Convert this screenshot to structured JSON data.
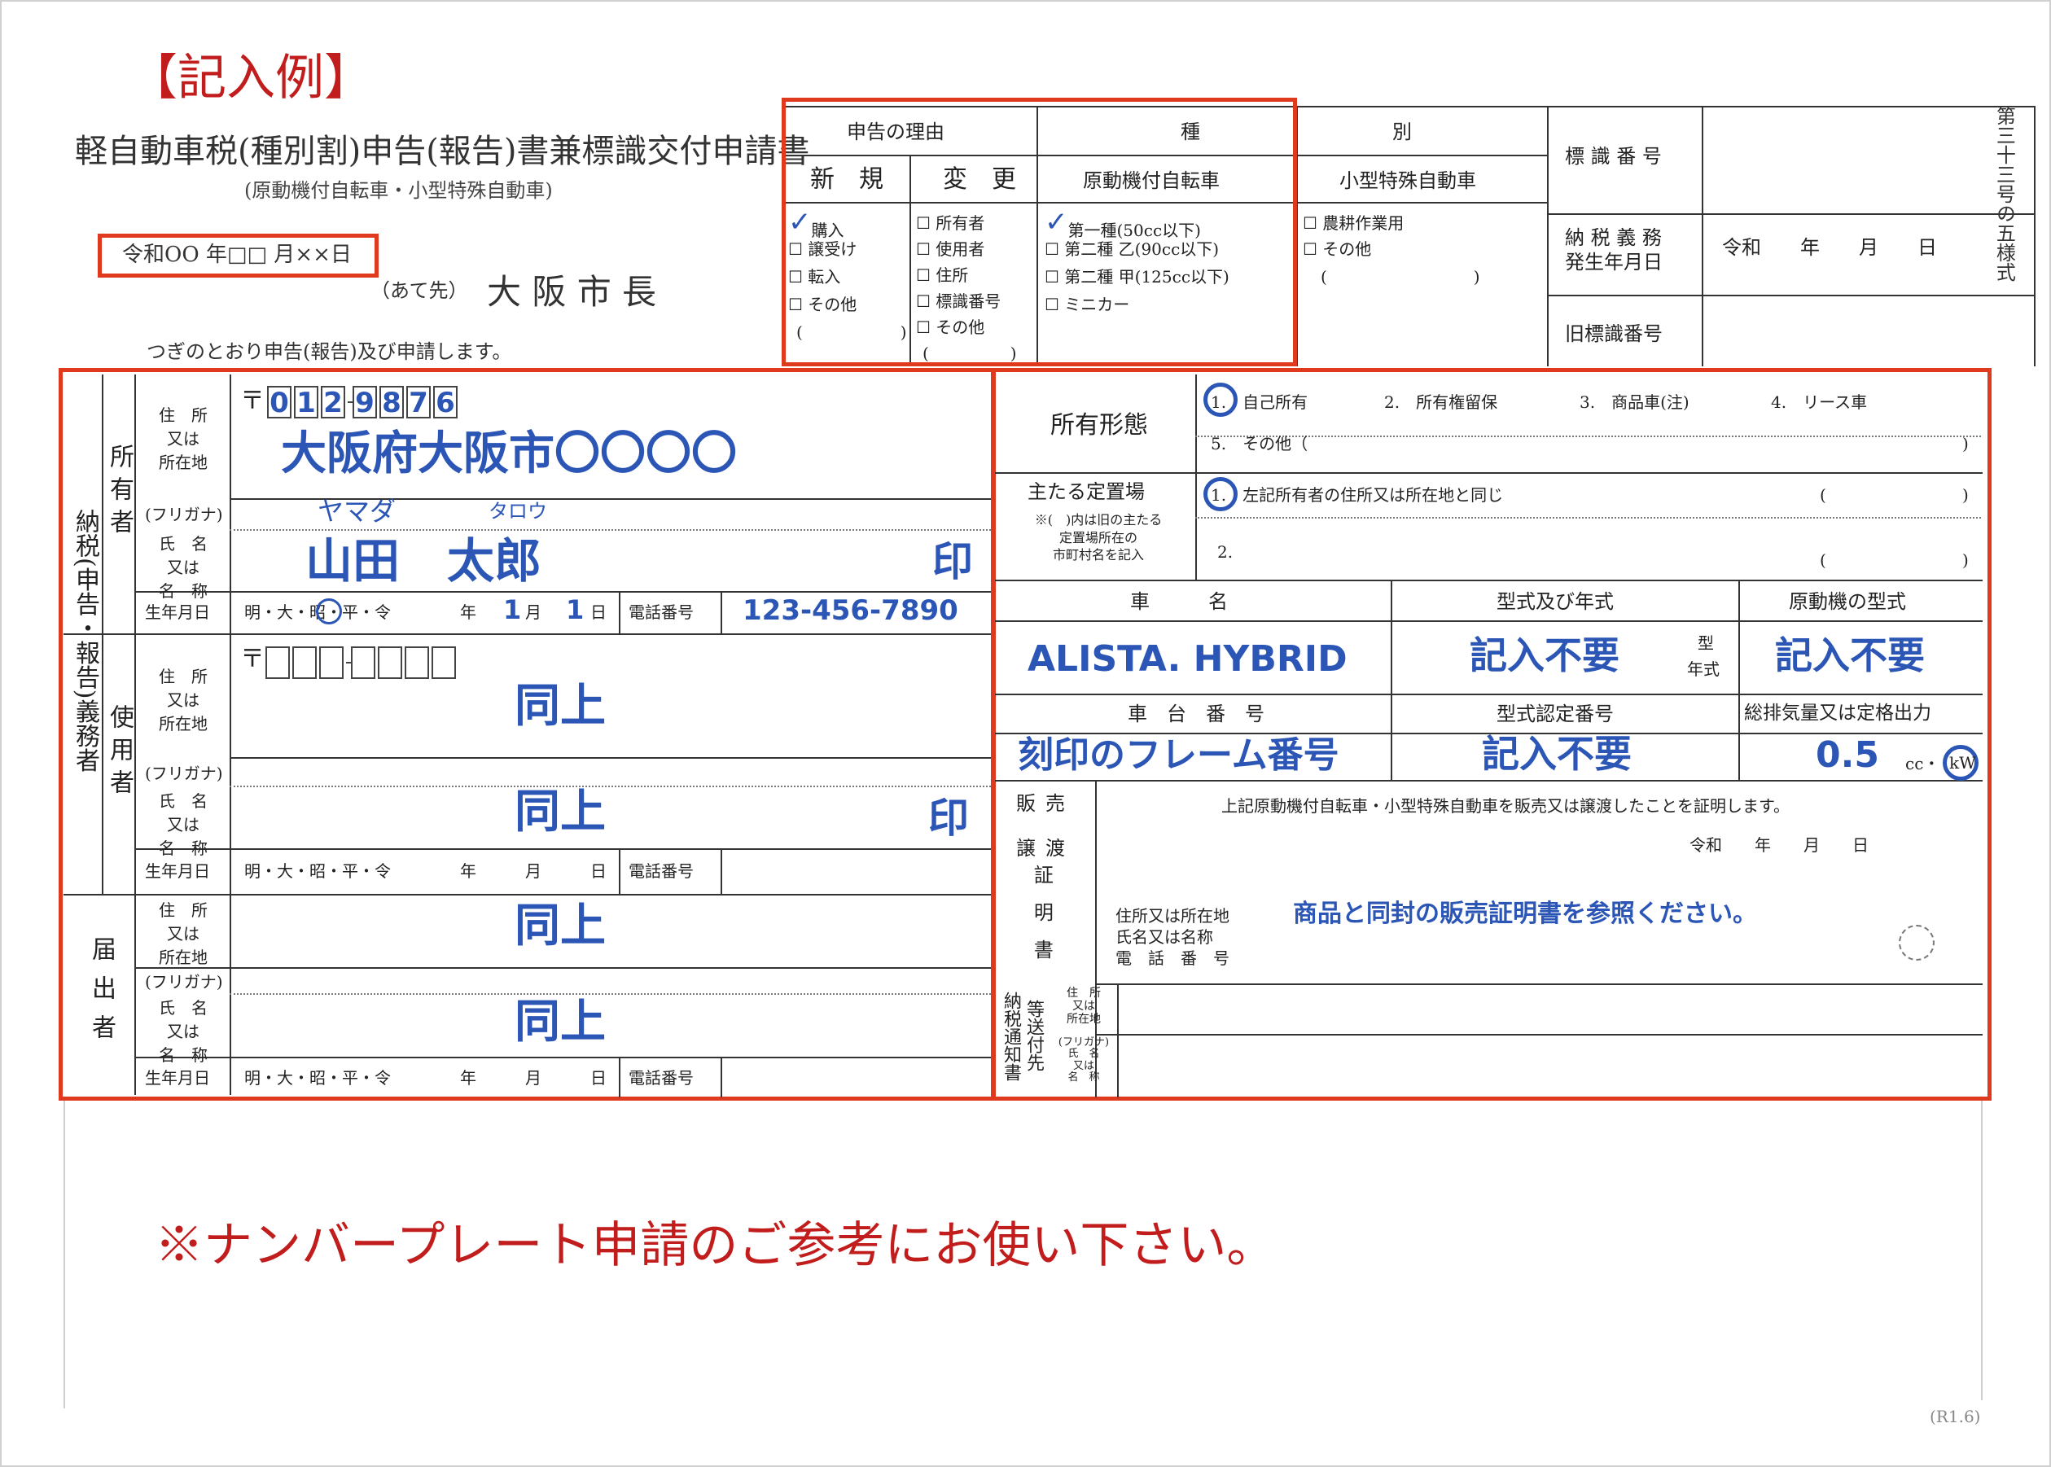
{
  "example_label": "【記入例】",
  "title": "軽自動車税(種別割)申告(報告)書兼標識交付申請書",
  "subtitle": "(原動機付自転車・小型特殊自動車)",
  "date": "令和OO 年□□ 月××日",
  "addressee_prefix": "（あて先）",
  "addressee": "大 阪 市 長",
  "intro": "つぎのとおり申告(報告)及び申請します。",
  "side_label": "第三十三号の五様式",
  "reason": {
    "header": "申告の理由",
    "new_header": "新　規",
    "change_header": "変　更",
    "new_items": [
      {
        "label": "購入",
        "checked": true
      },
      {
        "label": "譲受け",
        "checked": false
      },
      {
        "label": "転入",
        "checked": false
      },
      {
        "label": "その他",
        "checked": false
      }
    ],
    "new_paren": "(　　　　　　)",
    "change_items": [
      {
        "label": "所有者",
        "checked": false
      },
      {
        "label": "使用者",
        "checked": false
      },
      {
        "label": "住所",
        "checked": false
      },
      {
        "label": "標識番号",
        "checked": false
      },
      {
        "label": "その他",
        "checked": false
      }
    ],
    "change_paren": "(　　　　　)"
  },
  "type": {
    "header_left": "種",
    "header_right": "別",
    "moped_header": "原動機付自転車",
    "special_header": "小型特殊自動車",
    "moped_items": [
      {
        "label": "第一種(50cc以下)",
        "checked": true
      },
      {
        "label": "第二種 乙(90cc以下)",
        "checked": false
      },
      {
        "label": "第二種 甲(125cc以下)",
        "checked": false
      },
      {
        "label": "ミニカー",
        "checked": false
      }
    ],
    "special_items": [
      {
        "label": "農耕作業用",
        "checked": false
      },
      {
        "label": "その他",
        "checked": false
      }
    ],
    "special_paren": "(　　　　　　　　　)"
  },
  "right_header": {
    "plate_number_label": "標 識 番 号",
    "tax_date_label_1": "納 税 義 務",
    "tax_date_label_2": "発生年月日",
    "tax_date_value": "令和　　年　　月　　日",
    "old_plate_label": "旧標識番号"
  },
  "left_section": {
    "taxpayer_vertical": "納税(申告・報告)義務者",
    "owner_vertical": "所有者",
    "user_vertical": "使用者",
    "filer_vertical": "届出者",
    "address_label": [
      "住　所",
      "又は",
      "所在地"
    ],
    "furigana_label": "(フリガナ)",
    "name_label": [
      "氏　名",
      "又は",
      "名　称"
    ],
    "birth_label": "生年月日",
    "era_options": "明・大・昭・平・令",
    "year_unit": "年",
    "month_unit": "月",
    "day_unit": "日",
    "phone_label": "電話番号",
    "postal_mark": "〒",
    "seal": "印",
    "owner": {
      "postal": [
        "0",
        "1",
        "2",
        "9",
        "8",
        "7",
        "6"
      ],
      "address": "大阪府大阪市〇〇〇〇",
      "furigana_family": "ヤマダ",
      "furigana_given": "タロウ",
      "name": "山田　太郎",
      "birth_month": "1",
      "birth_day": "1",
      "phone": "123-456-7890"
    },
    "same_as_above": "同上"
  },
  "right_section": {
    "ownership_label": "所有形態",
    "ownership_options": [
      "1.　自己所有",
      "2.　所有権留保",
      "3.　商品車(注)",
      "4.　リース車"
    ],
    "ownership_other": "5.　その他（",
    "close_paren": ")",
    "storage_label": "主たる定置場",
    "storage_note": [
      "※(　)内は旧の主たる",
      "定置場所在の",
      "市町村名を記入"
    ],
    "storage_1": "1.　左記所有者の住所又は所在地と同じ",
    "storage_2": "2.",
    "open_paren": "(",
    "vehicle_name_label": "車　　　名",
    "model_year_label": "型式及び年式",
    "engine_model_label": "原動機の型式",
    "vehicle_name": "ALISTA. HYBRID",
    "model_year_value": "記入不要",
    "model_year_side_1": "型",
    "model_year_side_2": "年式",
    "engine_model_value": "記入不要",
    "frame_label": "車　台　番　号",
    "cert_label": "型式認定番号",
    "displacement_label": "総排気量又は定格出力",
    "frame_value": "刻印のフレーム番号",
    "cert_value": "記入不要",
    "displacement_value": "0.5",
    "unit_cc": "cc・",
    "unit_kw": "kW",
    "sales_vertical_1": "販売",
    "sales_vertical_2": "譲渡",
    "sales_vertical_3": "証明書",
    "sales_statement": "上記原動機付自転車・小型特殊自動車を販売又は譲渡したことを証明します。",
    "sales_date": "令和　　年　　月　　日",
    "sales_fields": [
      "住所又は所在地",
      "氏名又は名称",
      "電　話　番　号"
    ],
    "sales_note": "商品と同封の販売証明書を参照ください。",
    "tax_notice_vertical": "納税通知書",
    "send_to_vertical": "等送付先",
    "send_address": [
      "住　所",
      "又は",
      "所在地"
    ],
    "send_name": [
      "(フリガナ)",
      "氏　名",
      "又は",
      "名　称"
    ]
  },
  "footer_note": "※ナンバープレート申請のご参考にお使い下さい。",
  "footer_code": "(R1.6)",
  "colors": {
    "red_border": "#e03a1e",
    "blue_ink": "#2c56b6",
    "red_text": "#c21d1d"
  }
}
